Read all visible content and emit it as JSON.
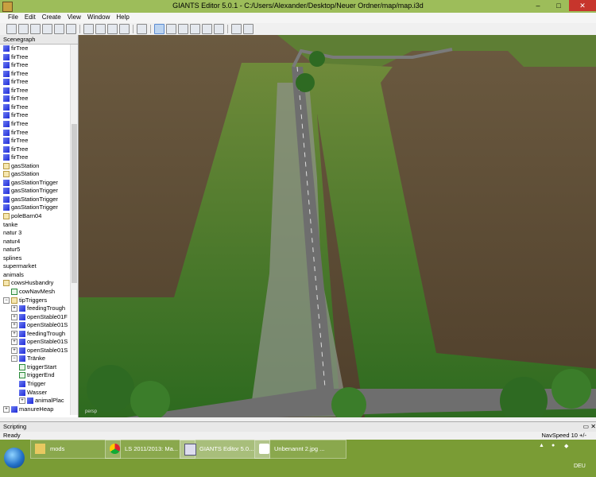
{
  "window": {
    "title": "GIANTS Editor 5.0.1 - C:/Users/Alexander/Desktop/Neuer Ordner/map/map.i3d",
    "min": "–",
    "max": "□",
    "close": "✕"
  },
  "menu": [
    "File",
    "Edit",
    "Create",
    "View",
    "Window",
    "Help"
  ],
  "sidebar": {
    "title": "Scenegraph",
    "items": [
      {
        "label": "firTree",
        "icon": "cube",
        "indent": 0
      },
      {
        "label": "firTree",
        "icon": "cube",
        "indent": 0
      },
      {
        "label": "firTree",
        "icon": "cube",
        "indent": 0
      },
      {
        "label": "firTree",
        "icon": "cube",
        "indent": 0
      },
      {
        "label": "firTree",
        "icon": "cube",
        "indent": 0
      },
      {
        "label": "firTree",
        "icon": "cube",
        "indent": 0
      },
      {
        "label": "firTree",
        "icon": "cube",
        "indent": 0
      },
      {
        "label": "firTree",
        "icon": "cube",
        "indent": 0
      },
      {
        "label": "firTree",
        "icon": "cube",
        "indent": 0
      },
      {
        "label": "firTree",
        "icon": "cube",
        "indent": 0
      },
      {
        "label": "firTree",
        "icon": "cube",
        "indent": 0
      },
      {
        "label": "firTree",
        "icon": "cube",
        "indent": 0
      },
      {
        "label": "firTree",
        "icon": "cube",
        "indent": 0
      },
      {
        "label": "firTree",
        "icon": "cube",
        "indent": 0
      },
      {
        "label": "gasStation",
        "icon": "group",
        "indent": 0
      },
      {
        "label": "gasStation",
        "icon": "group",
        "indent": 0
      },
      {
        "label": "gasStationTrigger",
        "icon": "cube",
        "indent": 0
      },
      {
        "label": "gasStationTrigger",
        "icon": "cube",
        "indent": 0
      },
      {
        "label": "gasStationTrigger",
        "icon": "cube",
        "indent": 0
      },
      {
        "label": "gasStationTrigger",
        "icon": "cube",
        "indent": 0
      },
      {
        "label": "poleBarn04",
        "icon": "group",
        "indent": 0
      },
      {
        "label": "tanke",
        "icon": "none",
        "indent": 0
      },
      {
        "label": "natur 3",
        "icon": "none",
        "indent": 0
      },
      {
        "label": "natur4",
        "icon": "none",
        "indent": 0
      },
      {
        "label": "natur5",
        "icon": "none",
        "indent": 0
      },
      {
        "label": "splines",
        "icon": "none",
        "indent": 0
      },
      {
        "label": "supermarket",
        "icon": "none",
        "indent": 0
      },
      {
        "label": "animals",
        "icon": "none",
        "indent": 0
      },
      {
        "label": "cowsHusbandry",
        "icon": "group",
        "indent": 0
      },
      {
        "label": "cowNavMesh",
        "icon": "mesh",
        "indent": 1
      },
      {
        "label": "tipTriggers",
        "icon": "group",
        "indent": 0,
        "exp": "−"
      },
      {
        "label": "feedingTrough",
        "icon": "cube",
        "indent": 1,
        "exp": "+"
      },
      {
        "label": "openStable01F",
        "icon": "cube",
        "indent": 1,
        "exp": "+"
      },
      {
        "label": "openStable01S",
        "icon": "cube",
        "indent": 1,
        "exp": "+"
      },
      {
        "label": "feedingTrough",
        "icon": "cube",
        "indent": 1,
        "exp": "+"
      },
      {
        "label": "openStable01S",
        "icon": "cube",
        "indent": 1,
        "exp": "+"
      },
      {
        "label": "openStable01S",
        "icon": "cube",
        "indent": 1,
        "exp": "+"
      },
      {
        "label": "Tränke",
        "icon": "cube",
        "indent": 1,
        "exp": "−"
      },
      {
        "label": "triggerStart",
        "icon": "mesh",
        "indent": 2
      },
      {
        "label": "triggerEnd",
        "icon": "mesh",
        "indent": 2
      },
      {
        "label": "Trigger",
        "icon": "cube",
        "indent": 2
      },
      {
        "label": "Wasser",
        "icon": "cube",
        "indent": 2
      },
      {
        "label": "animalPlac",
        "icon": "cube",
        "indent": 2,
        "exp": "+"
      },
      {
        "label": "manureHeap",
        "icon": "cube",
        "indent": 0,
        "exp": "+"
      }
    ]
  },
  "viewport": {
    "camera_label": "persp"
  },
  "scripting": {
    "title": "Scripting",
    "buttons": "▭ ✕"
  },
  "status": {
    "left": "Ready",
    "right": "NavSpeed 10 +/-"
  },
  "taskbar": {
    "items": [
      {
        "label": "mods",
        "icon": "folder"
      },
      {
        "label": "LS 2011/2013: Ma...",
        "icon": "chrome"
      },
      {
        "label": "GIANTS Editor 5.0...",
        "icon": "giants"
      },
      {
        "label": "Unbenannt 2.jpg ...",
        "icon": "paint"
      }
    ],
    "lang": "DEU"
  }
}
